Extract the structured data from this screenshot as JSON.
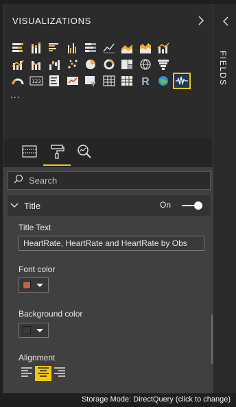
{
  "viz_pane": {
    "title": "VISUALIZATIONS",
    "more_label": "...",
    "icon_rows": [
      [
        "stacked-bar-chart-icon",
        "stacked-column-chart-icon",
        "clustered-bar-chart-icon",
        "clustered-column-chart-icon",
        "100-stacked-bar-chart-icon",
        "line-chart-icon",
        "area-chart-icon",
        "stacked-area-chart-icon",
        "line-and-column-chart-icon"
      ],
      [
        "line-and-stacked-column-chart-icon",
        "ribbon-chart-icon",
        "waterfall-chart-icon",
        "scatter-chart-icon",
        "pie-chart-icon",
        "donut-chart-icon",
        "treemap-icon",
        "map-icon",
        "funnel-chart-icon"
      ],
      [
        "gauge-icon",
        "card-icon",
        "multi-row-card-icon",
        "kpi-icon",
        "slicer-icon",
        "table-icon",
        "matrix-icon",
        "r-script-visual-icon",
        "arcgis-map-icon",
        "custom-visual-icon"
      ]
    ],
    "selected_icon": "custom-visual-icon"
  },
  "pane_tabs": {
    "items": [
      {
        "name": "tab-fields",
        "icon": "fields-grid-icon"
      },
      {
        "name": "tab-format",
        "icon": "paint-roller-icon"
      },
      {
        "name": "tab-analytics",
        "icon": "analytics-magnifier-icon"
      }
    ],
    "active": "tab-format"
  },
  "format": {
    "search": {
      "placeholder": "Search"
    },
    "title_card": {
      "label": "Title",
      "toggle_label": "On",
      "toggle_on": true,
      "title_text_label": "Title Text",
      "title_text_value": "HeartRate, HeartRate and HeartRate by Obs",
      "font_color_label": "Font color",
      "font_color": "#c0614a",
      "background_color_label": "Background color",
      "background_color": "#3a3a3a",
      "alignment_label": "Alignment",
      "alignment_options": [
        "left",
        "center",
        "right"
      ],
      "alignment_selected": "center"
    }
  },
  "fields_pane": {
    "label": "FIELDS"
  },
  "status_bar": {
    "text": "Storage Mode: DirectQuery (click to change)"
  },
  "colors": {
    "accent": "#f2c811",
    "pane_bg": "#2b2b2b",
    "format_bg": "#404040"
  }
}
